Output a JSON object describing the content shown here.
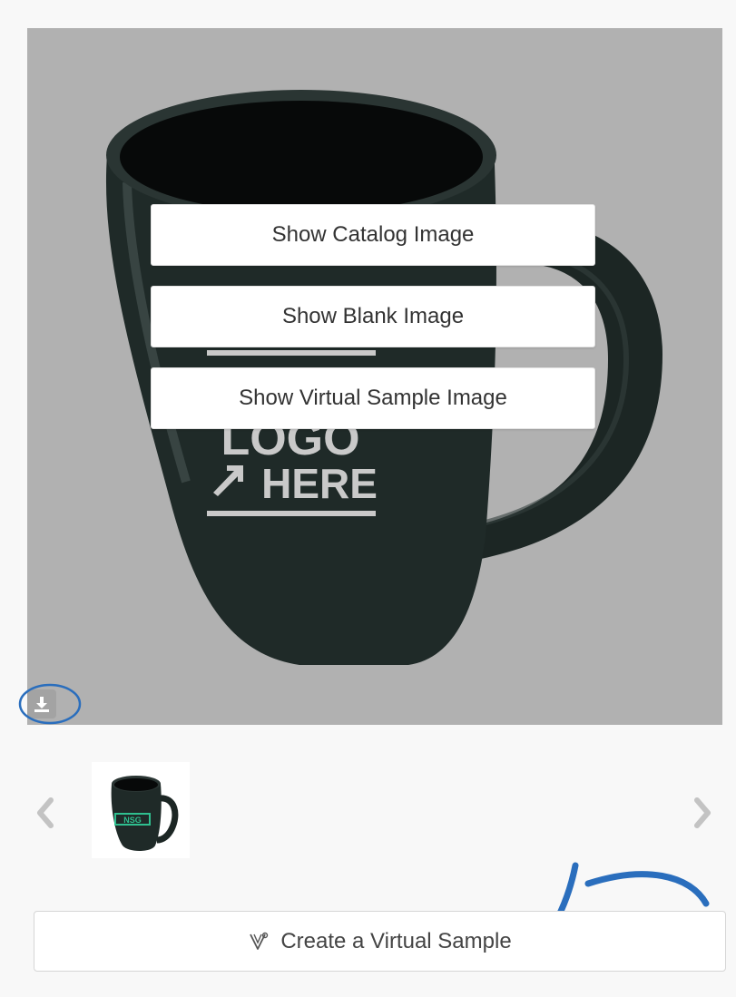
{
  "overlay_menu": {
    "catalog_label": "Show Catalog Image",
    "blank_label": "Show Blank Image",
    "virtual_label": "Show Virtual Sample Image"
  },
  "product_image": {
    "imprint_line1": "LOGO",
    "imprint_line2": "HERE",
    "mug_color": "#1f2a28",
    "background_color": "#b1b1b1"
  },
  "thumbnails": {
    "prev_icon": "chevron-left-icon",
    "next_icon": "chevron-right-icon",
    "thumb_logo_text": "NSG"
  },
  "actions": {
    "download_icon": "download-icon",
    "create_virtual_sample_label": "Create a Virtual Sample",
    "create_virtual_sample_icon": "virtual-sample-icon"
  },
  "annotations": {
    "color": "#2a6ebd"
  }
}
